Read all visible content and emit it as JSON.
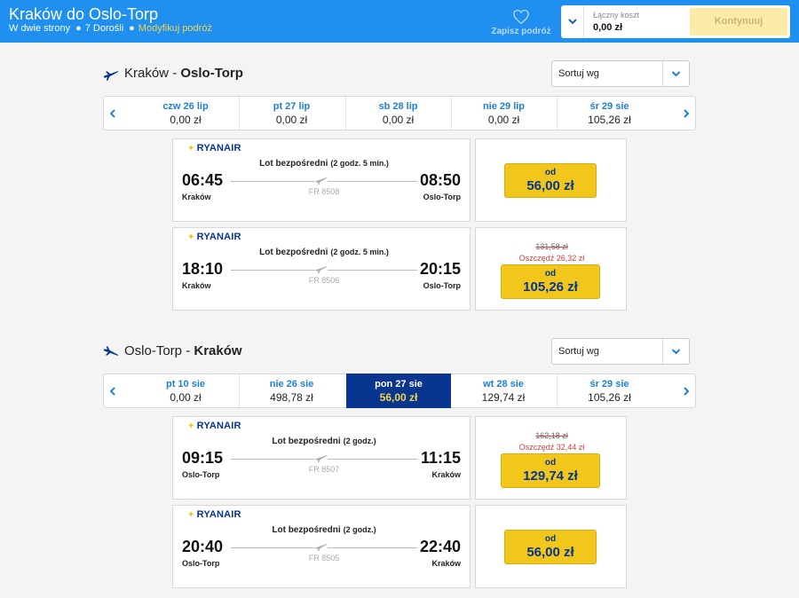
{
  "header": {
    "title": "Kraków do Oslo-Torp",
    "trip_type": "W dwie strony",
    "passengers": "7 Dorośli",
    "modify": "Modyfikuj podróż",
    "save_trip": "Zapisz podróż",
    "total_label": "Łączny koszt",
    "total_value": "0,00 zł",
    "continue": "Kontynuuj"
  },
  "outbound": {
    "from": "Kraków",
    "separator": " - ",
    "to": "Oslo-Torp",
    "sort_label": "Sortuj wg",
    "dates": [
      {
        "day": "czw 26 lip",
        "price": "0,00 zł"
      },
      {
        "day": "pt 27 lip",
        "price": "0,00 zł"
      },
      {
        "day": "sb 28 lip",
        "price": "0,00 zł"
      },
      {
        "day": "nie 29 lip",
        "price": "0,00 zł"
      },
      {
        "day": "śr 29 sie",
        "price": "105,26 zł"
      }
    ],
    "flights": [
      {
        "airline": "RYANAIR",
        "type": "Lot bezpośredni",
        "duration": "(2 godz. 5 min.)",
        "dep_time": "06:45",
        "arr_time": "08:50",
        "dep_city": "Kraków",
        "arr_city": "Oslo-Torp",
        "flight_no": "FR 8508",
        "from_label": "od",
        "price": "56,00 zł"
      },
      {
        "airline": "RYANAIR",
        "type": "Lot bezpośredni",
        "duration": "(2 godz. 5 min.)",
        "dep_time": "18:10",
        "arr_time": "20:15",
        "dep_city": "Kraków",
        "arr_city": "Oslo-Torp",
        "flight_no": "FR 8506",
        "old_price": "131,58 zł",
        "saving": "Oszczędź  26,32 zł",
        "from_label": "od",
        "price": "105,26 zł"
      }
    ]
  },
  "inbound": {
    "from": "Oslo-Torp",
    "separator": " - ",
    "to": "Kraków",
    "sort_label": "Sortuj wg",
    "dates": [
      {
        "day": "pt 10 sie",
        "price": "0,00 zł"
      },
      {
        "day": "nie 26 sie",
        "price": "498,78 zł"
      },
      {
        "day": "pon 27 sie",
        "price": "56,00 zł"
      },
      {
        "day": "wt 28 sie",
        "price": "129,74 zł"
      },
      {
        "day": "śr 29 sie",
        "price": "105,26 zł"
      }
    ],
    "flights": [
      {
        "airline": "RYANAIR",
        "type": "Lot bezpośredni",
        "duration": "(2 godz.)",
        "dep_time": "09:15",
        "arr_time": "11:15",
        "dep_city": "Oslo-Torp",
        "arr_city": "Kraków",
        "flight_no": "FR 8507",
        "old_price": "162,18 zł",
        "saving": "Oszczędź  32,44 zł",
        "from_label": "od",
        "price": "129,74 zł"
      },
      {
        "airline": "RYANAIR",
        "type": "Lot bezpośredni",
        "duration": "(2 godz.)",
        "dep_time": "20:40",
        "arr_time": "22:40",
        "dep_city": "Oslo-Torp",
        "arr_city": "Kraków",
        "flight_no": "FR 8505",
        "from_label": "od",
        "price": "56,00 zł"
      }
    ]
  },
  "colors": {
    "header_blue": "#1f8ff0",
    "navy": "#073590",
    "yellow": "#f1c71c",
    "red": "#d23c3c"
  }
}
